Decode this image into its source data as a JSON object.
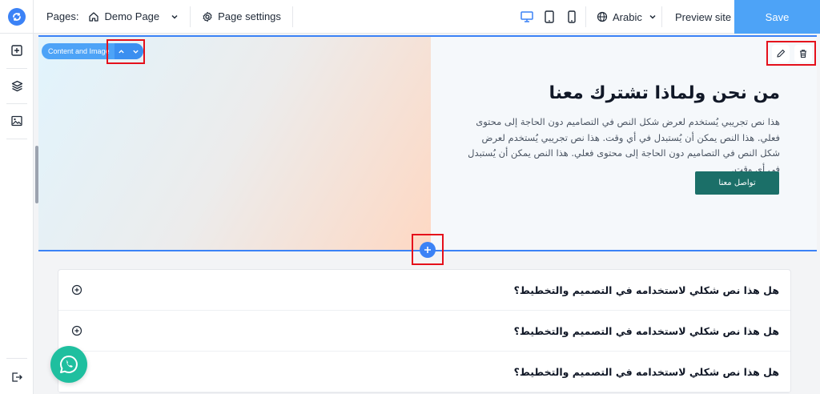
{
  "topbar": {
    "pages_label": "Pages:",
    "page_name": "Demo Page",
    "page_settings_label": "Page settings",
    "language": "Arabic",
    "preview_label": "Preview site",
    "save_label": "Save",
    "devices": [
      "desktop-icon",
      "tablet-icon",
      "mobile-icon"
    ],
    "active_device": "desktop"
  },
  "rail": {
    "items": [
      "add-section-icon",
      "layers-icon",
      "media-icon"
    ],
    "bottom": "exit-icon"
  },
  "section": {
    "badge_label": "Content and Image",
    "heading": "من نحن ولماذا تشترك معنا",
    "body": "هذا نص تجريبي يُستخدم لعرض شكل النص في التصاميم دون الحاجة إلى محتوى فعلي. هذا النص يمكن أن يُستبدل في أي وقت. هذا نص تجريبي يُستخدم لعرض شكل النص في التصاميم دون الحاجة إلى محتوى فعلي. هذا النص يمكن أن يُستبدل في أي وقت.",
    "cta_label": "تواصل معنا"
  },
  "faq": {
    "items": [
      {
        "question": "هل هذا نص شكلي لاستخدامه في التصميم والتخطيط؟"
      },
      {
        "question": "هل هذا نص شكلي لاستخدامه في التصميم والتخطيط؟"
      },
      {
        "question": "هل هذا نص شكلي لاستخدامه في التصميم والتخطيط؟"
      }
    ]
  },
  "colors": {
    "accent": "#4da3f7",
    "cta": "#1b6f68",
    "highlight": "#e5101b",
    "whatsapp": "#1fbf9f"
  }
}
